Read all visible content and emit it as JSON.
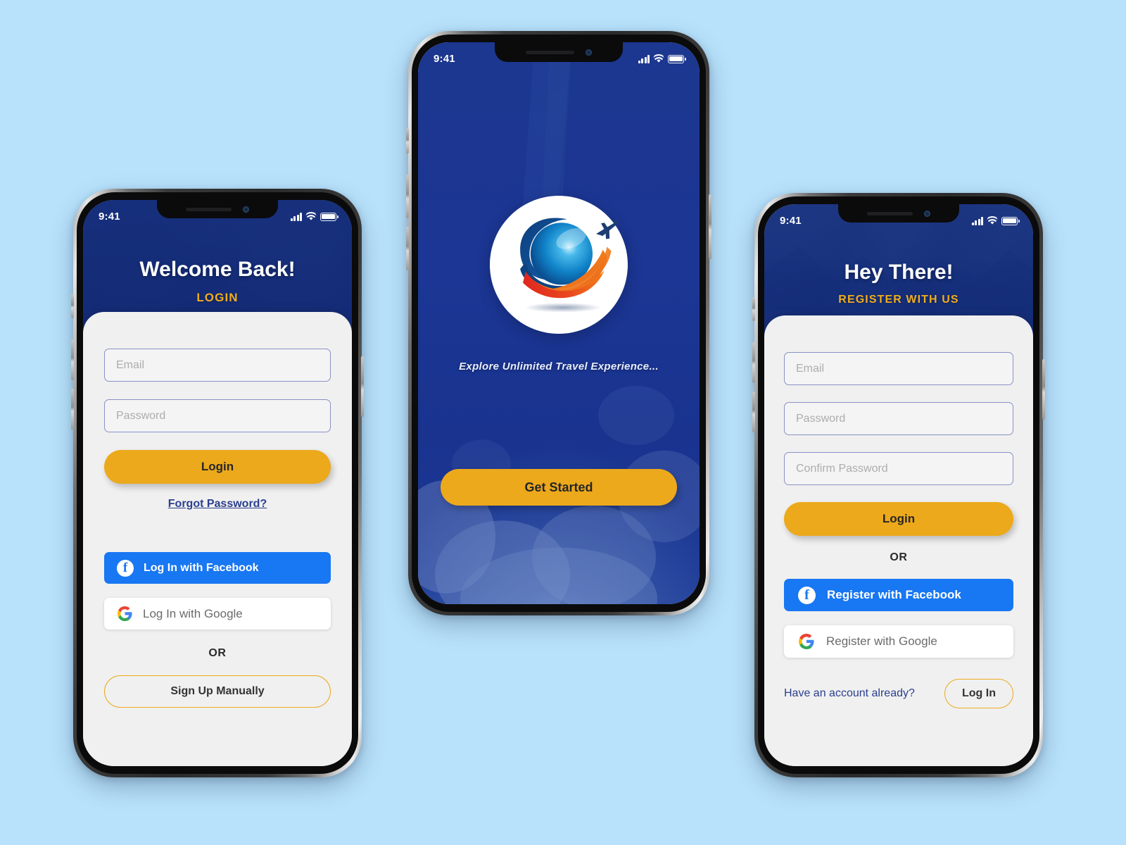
{
  "page": {
    "background_color": "#b8e2fc",
    "brand_blue": "#1c378f",
    "brand_yellow": "#eca91c",
    "facebook_blue": "#1877f2",
    "card_bg": "#f0f0f0",
    "field_border": "#8892c4"
  },
  "status_bar": {
    "time": "9:41",
    "signal_icon": "cellular-bars-icon",
    "wifi_icon": "wifi-icon",
    "battery_icon": "battery-full-icon"
  },
  "screens": [
    {
      "id": "login",
      "name": "login-screen",
      "header": {
        "title": "Welcome Back!",
        "subtitle": "LOGIN",
        "background_image": "airport-lounge-photo"
      },
      "fields": [
        {
          "name": "email-input",
          "placeholder": "Email",
          "value": ""
        },
        {
          "name": "password-input",
          "placeholder": "Password",
          "value": ""
        }
      ],
      "primary_button": "Login",
      "forgot_link": "Forgot Password?",
      "social_buttons": [
        {
          "name": "facebook-login-button",
          "label": "Log In with Facebook",
          "icon": "facebook-icon"
        },
        {
          "name": "google-login-button",
          "label": "Log In with Google",
          "icon": "google-icon"
        }
      ],
      "divider_text": "OR",
      "outline_button": "Sign Up Manually"
    },
    {
      "id": "splash",
      "name": "splash-screen",
      "logo": {
        "name": "travel-globe-logo",
        "description": "globe-with-airplane-icon",
        "sphere_color": "#0f8fd4",
        "swoosh_orange": "#f07d1b",
        "swoosh_red": "#e23524",
        "swoosh_navy": "#0f3f7d"
      },
      "tagline": "Explore Unlimited Travel Experience...",
      "primary_button": "Get Started"
    },
    {
      "id": "register",
      "name": "register-screen",
      "header": {
        "title": "Hey There!",
        "subtitle": "REGISTER WITH US",
        "background_image": "mountain-lake-photo"
      },
      "fields": [
        {
          "name": "email-input",
          "placeholder": "Email",
          "value": ""
        },
        {
          "name": "password-input",
          "placeholder": "Password",
          "value": ""
        },
        {
          "name": "confirm-password-input",
          "placeholder": "Confirm Password",
          "value": ""
        }
      ],
      "primary_button": "Login",
      "divider_text": "OR",
      "social_buttons": [
        {
          "name": "facebook-register-button",
          "label": "Register with Facebook",
          "icon": "facebook-icon"
        },
        {
          "name": "google-register-button",
          "label": "Register with Google",
          "icon": "google-icon"
        }
      ],
      "footer": {
        "prompt": "Have an account already?",
        "action": "Log In"
      }
    }
  ]
}
